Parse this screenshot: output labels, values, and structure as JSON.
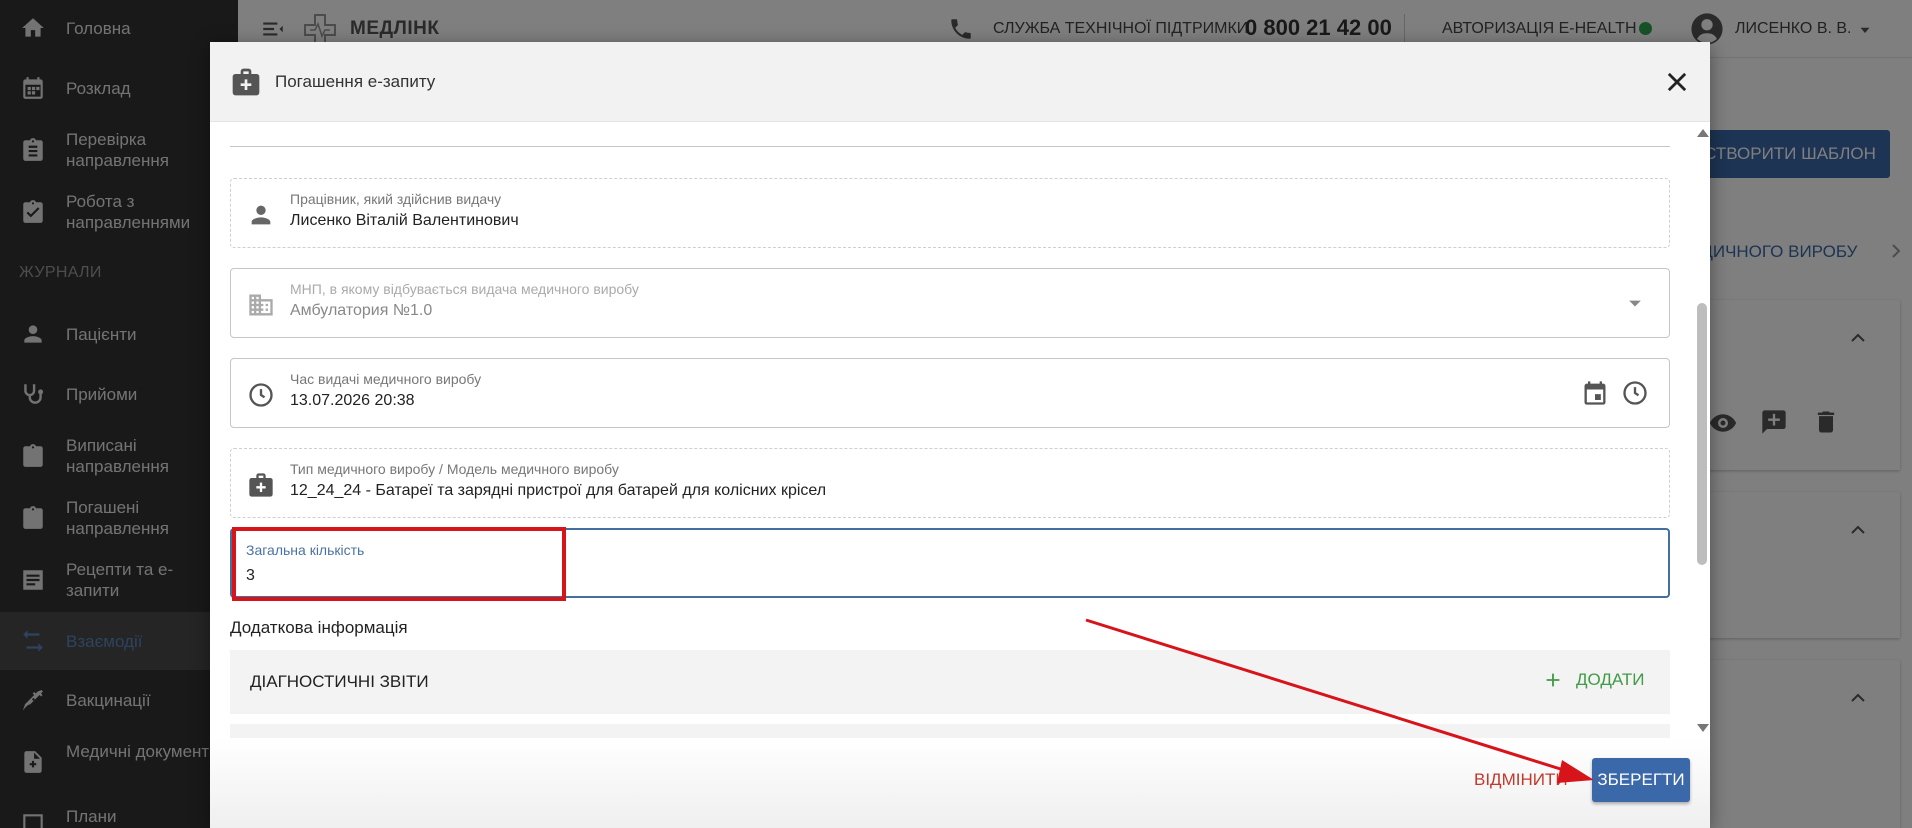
{
  "sidebar": {
    "items": [
      {
        "label": "Головна",
        "icon": "home-icon"
      },
      {
        "label": "Розклад",
        "icon": "calendar-icon"
      },
      {
        "label": "Перевірка направлення",
        "icon": "clipboard-icon"
      },
      {
        "label": "Робота з направленнями",
        "icon": "clipboard-check-icon"
      },
      {
        "label": "Пацієнти",
        "icon": "person-icon"
      },
      {
        "label": "Прийоми",
        "icon": "stethoscope-icon"
      },
      {
        "label": "Виписані направлення",
        "icon": "clipboard-icon"
      },
      {
        "label": "Погашені направлення",
        "icon": "clipboard-icon"
      },
      {
        "label": "Рецепти та е-запити",
        "icon": "list-icon"
      },
      {
        "label": "Взаємодії",
        "icon": "swap-icon",
        "active": true
      },
      {
        "label": "Вакцинації",
        "icon": "syringe-icon"
      },
      {
        "label": "Медичні документи",
        "icon": "document-plus-icon"
      },
      {
        "label": "Плани",
        "icon": "plan-icon"
      }
    ],
    "section_title": "ЖУРНАЛИ",
    "active_color": "#5b86bd"
  },
  "header": {
    "brand": "МЕДЛІНК",
    "support_label": "СЛУЖБА ТЕХНІЧНОЇ ПІДТРИМКИ",
    "phone": "0 800 21 42 00",
    "auth_label": "АВТОРИЗАЦІЯ E-HEALTH",
    "auth_status_color": "#2da44e",
    "user": "ЛИСЕНКО В. В."
  },
  "background": {
    "create_template": "СТВОРИТИ ШАБЛОН",
    "tab_label": "ЕДИЧНОГО ВИРОБУ"
  },
  "dialog": {
    "title": "Погашення е-запиту",
    "fields": {
      "worker": {
        "label": "Працівник, який здійснив видачу",
        "value": "Лисенко Віталій Валентинович"
      },
      "facility": {
        "label": "МНП, в якому відбувається видача медичного виробу",
        "value": "Амбулатория №1.0"
      },
      "time": {
        "label": "Час видачі медичного виробу",
        "value": "13.07.2026 20:38"
      },
      "device": {
        "label": "Тип медичного виробу / Модель медичного виробу",
        "value": "12_24_24 - Батареї та зарядні пристрої для батарей для колісних крісел"
      },
      "quantity": {
        "label": "Загальна кількість",
        "value": "3"
      }
    },
    "additional_info": "Додаткова інформація",
    "sections": [
      {
        "title": "ДІАГНОСТИЧНІ ЗВІТИ",
        "add": "ДОДАТИ"
      }
    ],
    "cancel": "ВІДМІНИТИ",
    "save": "ЗБЕРЕГТИ",
    "primary_color": "#3a68a8",
    "annotation_color": "#d7141a"
  }
}
